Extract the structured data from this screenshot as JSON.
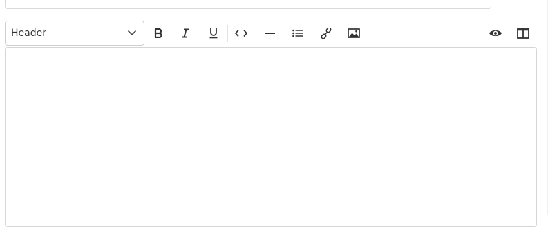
{
  "header_select": {
    "value": "Header",
    "icon": "chevron-down-icon"
  },
  "toolbar": {
    "buttons": [
      {
        "name": "bold-button",
        "icon": "bold-icon"
      },
      {
        "name": "italic-button",
        "icon": "italic-icon"
      },
      {
        "name": "underline-button",
        "icon": "underline-icon"
      },
      {
        "name": "code-button",
        "icon": "code-icon"
      },
      {
        "name": "horizontal-rule-button",
        "icon": "horizontal-rule-icon"
      },
      {
        "name": "bulleted-list-button",
        "icon": "list-icon"
      },
      {
        "name": "link-button",
        "icon": "link-icon"
      },
      {
        "name": "image-button",
        "icon": "image-icon"
      },
      {
        "name": "preview-button",
        "icon": "eye-icon"
      },
      {
        "name": "split-view-button",
        "icon": "columns-icon"
      }
    ]
  },
  "editor": {
    "value": ""
  },
  "colors": {
    "icon": "#333333",
    "border": "#d6d6d6"
  }
}
